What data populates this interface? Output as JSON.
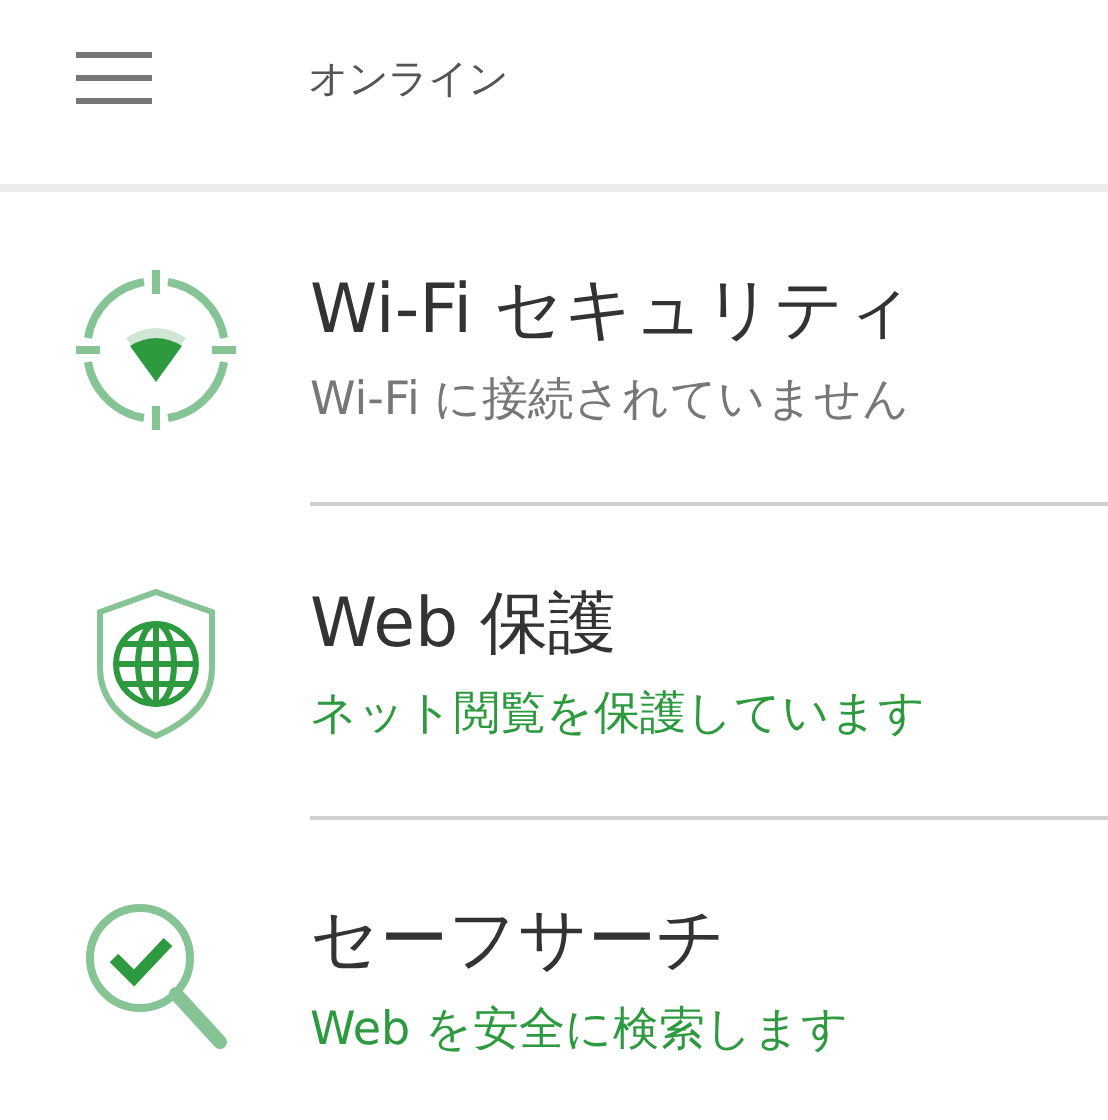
{
  "header": {
    "title": "オンライン"
  },
  "features": [
    {
      "kind": "wifi",
      "title": "Wi-Fi セキュリティ",
      "status": "Wi-Fi に接続されていません",
      "active": false
    },
    {
      "kind": "web",
      "title": "Web 保護",
      "status": "ネット閲覧を保護しています",
      "active": true
    },
    {
      "kind": "search",
      "title": "セーフサーチ",
      "status": "Web を安全に検索します",
      "active": true
    }
  ]
}
